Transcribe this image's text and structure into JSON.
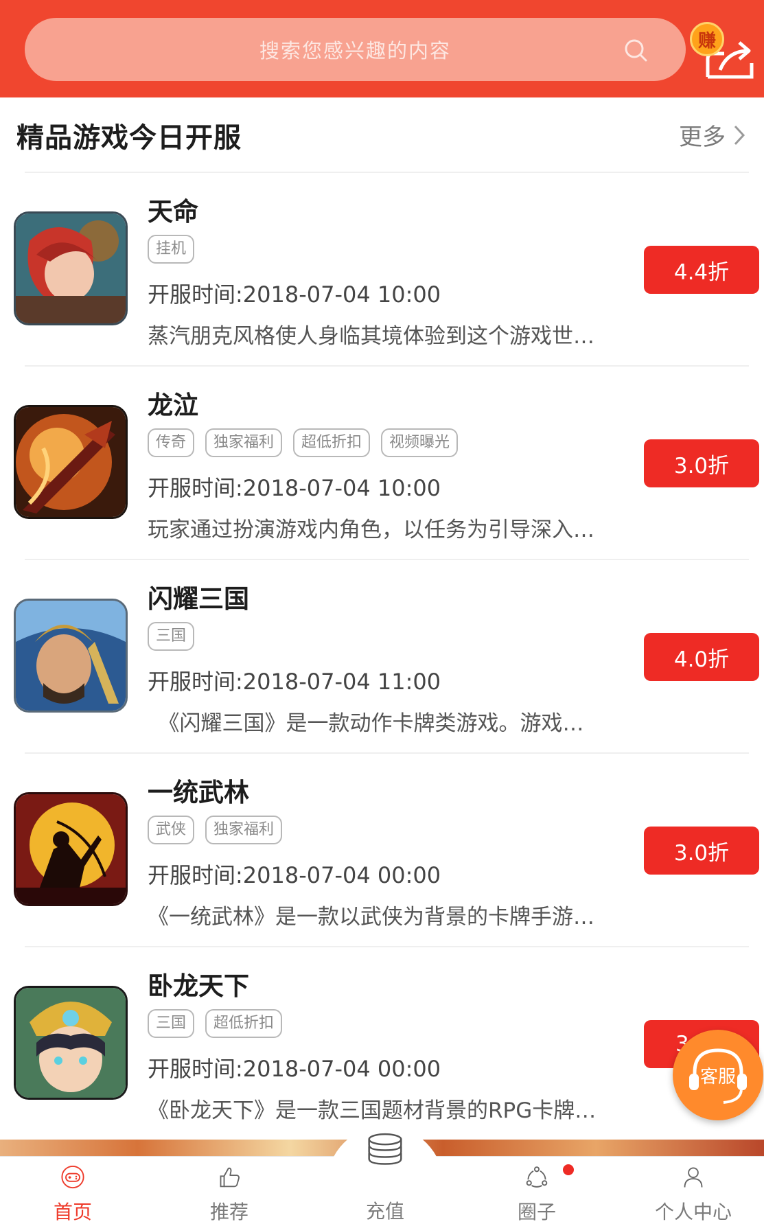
{
  "search": {
    "placeholder": "搜索您感兴趣的内容"
  },
  "header": {
    "earn_label": "赚"
  },
  "section": {
    "title": "精品游戏今日开服",
    "more_label": "更多"
  },
  "games": [
    {
      "name": "天命",
      "tags": [
        "挂机"
      ],
      "open_time": "开服时间:2018-07-04 10:00",
      "description": "蒸汽朋克风格使人身临其境体验到这个游戏世…",
      "discount": "4.4折"
    },
    {
      "name": "龙泣",
      "tags": [
        "传奇",
        "独家福利",
        "超低折扣",
        "视频曝光"
      ],
      "open_time": "开服时间:2018-07-04 10:00",
      "description": "玩家通过扮演游戏内角色，以任务为引导深入…",
      "discount": "3.0折"
    },
    {
      "name": "闪耀三国",
      "tags": [
        "三国"
      ],
      "open_time": "开服时间:2018-07-04 11:00",
      "description": "　《闪耀三国》是一款动作卡牌类游戏。游戏…",
      "discount": "4.0折"
    },
    {
      "name": "一统武林",
      "tags": [
        "武侠",
        "独家福利"
      ],
      "open_time": "开服时间:2018-07-04 00:00",
      "description": "《一统武林》是一款以武侠为背景的卡牌手游…",
      "discount": "3.0折"
    },
    {
      "name": "卧龙天下",
      "tags": [
        "三国",
        "超低折扣"
      ],
      "open_time": "开服时间:2018-07-04 00:00",
      "description": "《卧龙天下》是一款三国题材背景的RPG卡牌…",
      "discount": "3"
    }
  ],
  "service": {
    "label": "客服"
  },
  "tabs": [
    {
      "label": "首页",
      "icon": "gamepad-icon"
    },
    {
      "label": "推荐",
      "icon": "thumbs-up-icon"
    },
    {
      "label": "充值",
      "icon": "coins-icon"
    },
    {
      "label": "圈子",
      "icon": "circle-share-icon"
    },
    {
      "label": "个人中心",
      "icon": "user-icon"
    }
  ],
  "colors": {
    "brand": "#f0462f",
    "discount": "#ee2b25",
    "service": "#ff8a2c"
  }
}
